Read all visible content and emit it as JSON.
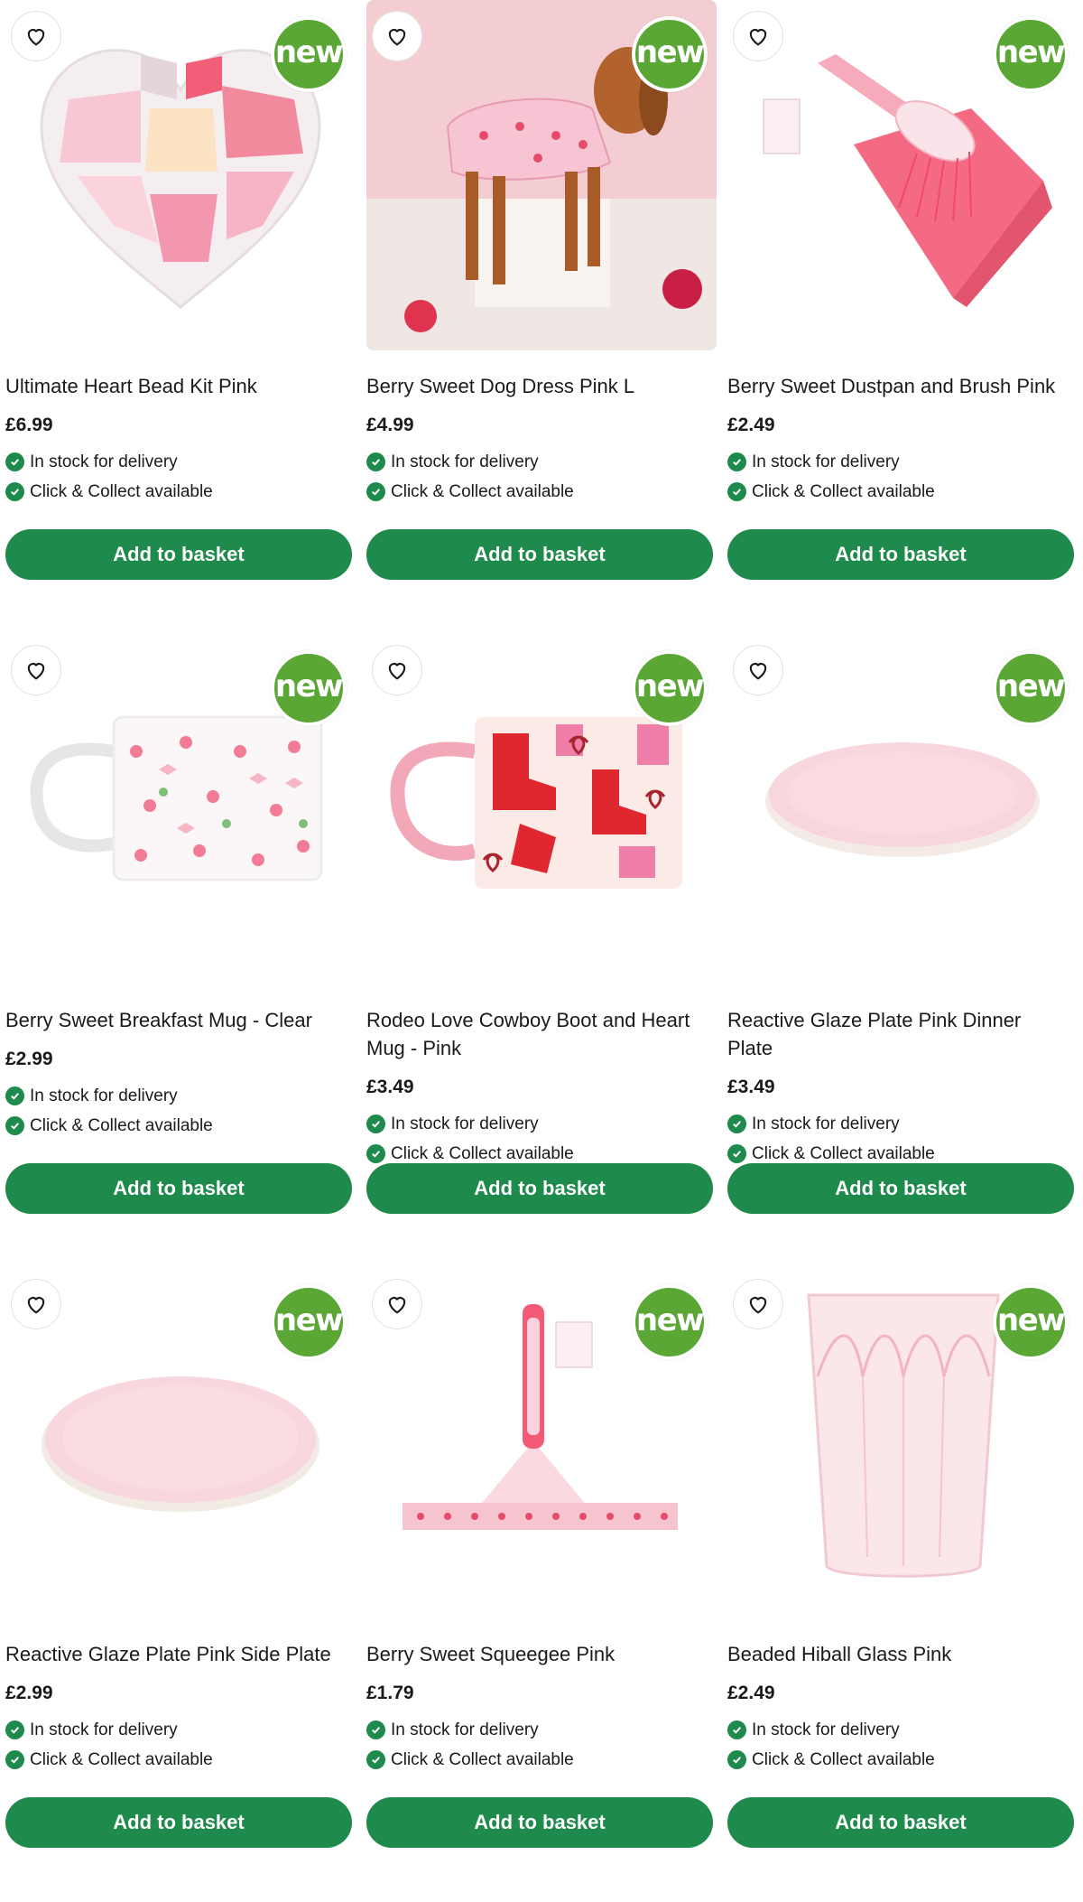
{
  "labels": {
    "new_badge": "new",
    "in_stock": "In stock for delivery",
    "click_collect": "Click & Collect available",
    "add_to_basket": "Add to basket"
  },
  "colors": {
    "brand_green": "#1e8a4c",
    "new_badge_green": "#5aa735"
  },
  "products": [
    {
      "title": "Ultimate Heart Bead Kit Pink",
      "price": "£6.99",
      "new": true,
      "image_icon": "heart-bead-kit"
    },
    {
      "title": "Berry Sweet Dog Dress Pink L",
      "price": "£4.99",
      "new": true,
      "image_icon": "dog-dress"
    },
    {
      "title": "Berry Sweet Dustpan and Brush Pink",
      "price": "£2.49",
      "new": true,
      "image_icon": "dustpan-brush"
    },
    {
      "title": "Berry Sweet Breakfast Mug - Clear",
      "price": "£2.99",
      "new": true,
      "image_icon": "clear-mug"
    },
    {
      "title": "Rodeo Love Cowboy Boot and Heart Mug - Pink",
      "price": "£3.49",
      "new": true,
      "image_icon": "cowboy-mug"
    },
    {
      "title": "Reactive Glaze Plate Pink Dinner Plate",
      "price": "£3.49",
      "new": true,
      "image_icon": "dinner-plate"
    },
    {
      "title": "Reactive Glaze Plate Pink Side Plate",
      "price": "£2.99",
      "new": true,
      "image_icon": "side-plate"
    },
    {
      "title": "Berry Sweet Squeegee Pink",
      "price": "£1.79",
      "new": true,
      "image_icon": "squeegee"
    },
    {
      "title": "Beaded Hiball Glass Pink",
      "price": "£2.49",
      "new": true,
      "image_icon": "hiball-glass"
    }
  ]
}
